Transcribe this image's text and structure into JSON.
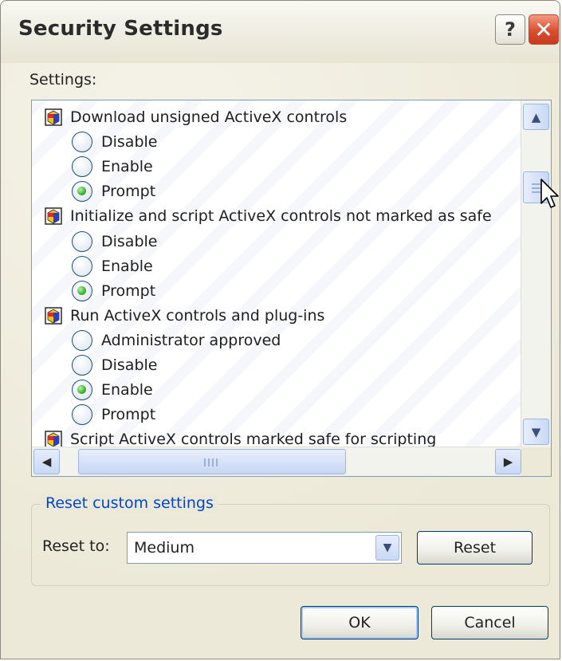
{
  "window": {
    "title": "Security Settings"
  },
  "titlebar": {
    "help_label": "?",
    "close_label": "✕"
  },
  "settings": {
    "label": "Settings:",
    "rows": [
      {
        "type": "category",
        "label": "Download unsigned ActiveX controls"
      },
      {
        "type": "option",
        "label": "Disable",
        "checked": false
      },
      {
        "type": "option",
        "label": "Enable",
        "checked": false
      },
      {
        "type": "option",
        "label": "Prompt",
        "checked": true
      },
      {
        "type": "category",
        "label": "Initialize and script ActiveX controls not marked as safe"
      },
      {
        "type": "option",
        "label": "Disable",
        "checked": false
      },
      {
        "type": "option",
        "label": "Enable",
        "checked": false
      },
      {
        "type": "option",
        "label": "Prompt",
        "checked": true
      },
      {
        "type": "category",
        "label": "Run ActiveX controls and plug-ins"
      },
      {
        "type": "option",
        "label": "Administrator approved",
        "checked": false
      },
      {
        "type": "option",
        "label": "Disable",
        "checked": false
      },
      {
        "type": "option",
        "label": "Enable",
        "checked": true
      },
      {
        "type": "option",
        "label": "Prompt",
        "checked": false
      },
      {
        "type": "category",
        "label": "Script ActiveX controls marked safe for scripting"
      }
    ]
  },
  "scrollbar": {
    "up_arrow": "▲",
    "down_arrow": "▼",
    "left_arrow": "◀",
    "right_arrow": "▶"
  },
  "reset_group": {
    "legend": "Reset custom settings",
    "reset_to_label": "Reset to:",
    "selected_value": "Medium",
    "dropdown_arrow": "▼",
    "reset_button": "Reset"
  },
  "footer": {
    "ok_label": "OK",
    "cancel_label": "Cancel"
  },
  "colors": {
    "accent": "#0046d5",
    "checked_green": "#3cb22e",
    "close_red": "#dc4e30"
  }
}
